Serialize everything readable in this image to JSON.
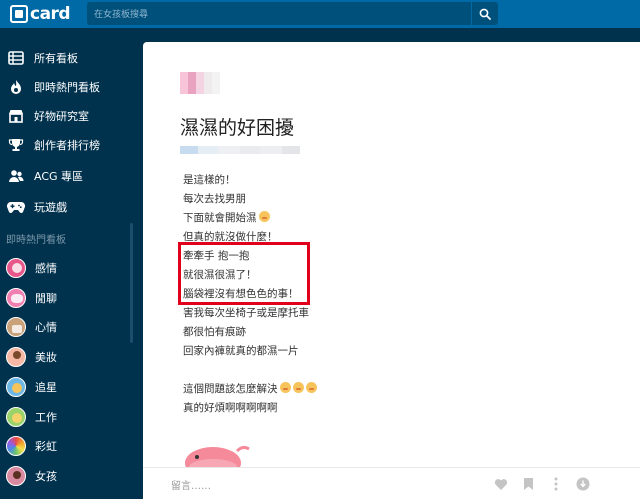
{
  "header": {
    "logo_text": "card",
    "search_placeholder": "在女孩板搜尋"
  },
  "sidebar": {
    "items": [
      {
        "label": "所有看板",
        "icon": "list-icon"
      },
      {
        "label": "即時熱門看板",
        "icon": "flame-icon"
      },
      {
        "label": "好物研究室",
        "icon": "store-icon"
      },
      {
        "label": "創作者排行榜",
        "icon": "trophy-icon"
      },
      {
        "label": "ACG 專區",
        "icon": "people-icon"
      },
      {
        "label": "玩遊戲",
        "icon": "gamepad-icon"
      }
    ],
    "section_label": "即時熱門看板",
    "boards": [
      {
        "label": "感情",
        "color": "#e8578a"
      },
      {
        "label": "閒聊",
        "color": "#f17fb0"
      },
      {
        "label": "心情",
        "color": "#c9a27a"
      },
      {
        "label": "美妝",
        "color": "#f4b8a5"
      },
      {
        "label": "追星",
        "color": "#6db7e6"
      },
      {
        "label": "工作",
        "color": "#9ad36a"
      },
      {
        "label": "彩虹",
        "color": "#f0a030"
      },
      {
        "label": "女孩",
        "color": "#d98aa0"
      }
    ]
  },
  "post": {
    "title": "濕濕的好困擾",
    "lines": [
      "是這樣的！",
      "每次去找男朋",
      "下面就會開始濕",
      "但真的就沒做什麼！",
      "牽牽手 抱一抱",
      "就很濕很濕了！",
      "腦袋裡沒有想色色的事！",
      "害我每次坐椅子或是摩托車",
      "都很怕有痕跡",
      "回家內褲就真的都濕一片",
      "",
      "這個問題該怎麼解決",
      "真的好煩啊啊啊啊啊"
    ]
  },
  "footer": {
    "comment_placeholder": "留言……"
  },
  "colors": {
    "topbar": "#006aa6",
    "sidebar": "#00324e",
    "highlight_border": "#e0001b"
  }
}
